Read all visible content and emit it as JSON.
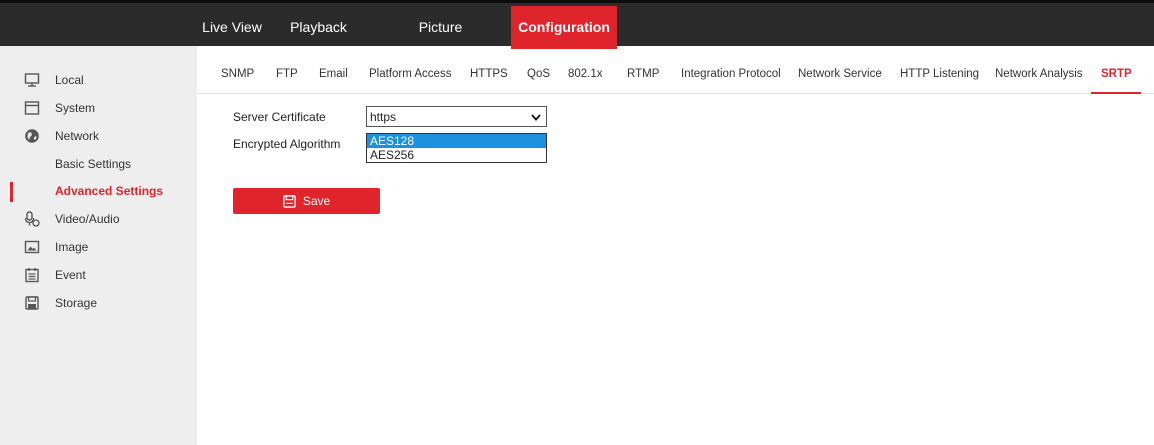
{
  "topnav": {
    "tabs": [
      {
        "label": "Live View"
      },
      {
        "label": "Playback"
      },
      {
        "label": "Picture"
      },
      {
        "label": "Configuration",
        "active": true
      }
    ]
  },
  "sidebar": {
    "items": [
      {
        "label": "Local",
        "icon": "monitor-icon"
      },
      {
        "label": "System",
        "icon": "system-icon"
      },
      {
        "label": "Network",
        "icon": "globe-icon"
      },
      {
        "label": "Basic Settings"
      },
      {
        "label": "Advanced Settings",
        "active": true
      },
      {
        "label": "Video/Audio",
        "icon": "microphone-icon"
      },
      {
        "label": "Image",
        "icon": "image-icon"
      },
      {
        "label": "Event",
        "icon": "calendar-icon"
      },
      {
        "label": "Storage",
        "icon": "storage-icon"
      }
    ]
  },
  "subtabs": [
    "SNMP",
    "FTP",
    "Email",
    "Platform Access",
    "HTTPS",
    "QoS",
    "802.1x",
    "RTMP",
    "Integration Protocol",
    "Network Service",
    "HTTP Listening",
    "Network Analysis",
    "SRTP"
  ],
  "active_subtab": "SRTP",
  "form": {
    "server_certificate_label": "Server Certificate",
    "server_certificate_value": "https",
    "encrypted_algorithm_label": "Encrypted Algorithm",
    "encrypted_algorithm_options": [
      "AES128",
      "AES256"
    ],
    "encrypted_algorithm_selected": "AES128"
  },
  "save_label": "Save",
  "colors": {
    "accent": "#e0242b",
    "topbar": "#2b2b2b",
    "sidebar": "#eeeeee",
    "dropdown_highlight": "#1e90e0"
  }
}
